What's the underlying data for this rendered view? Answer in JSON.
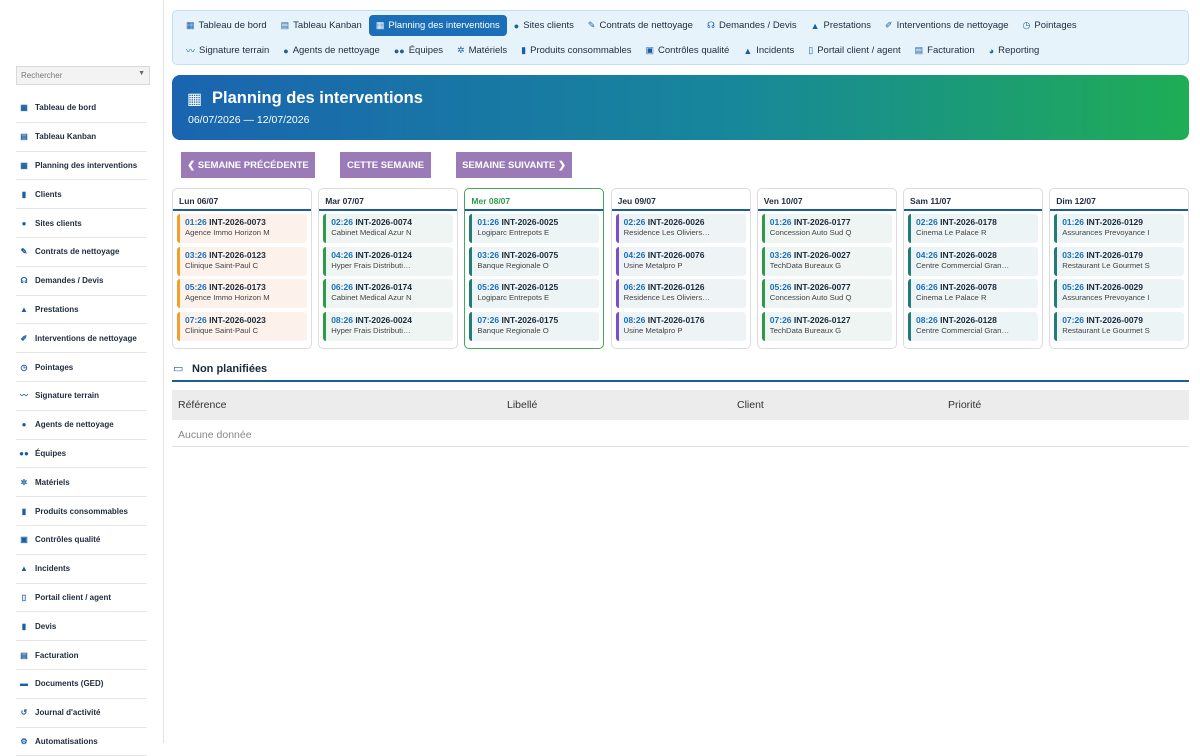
{
  "sidebar": {
    "search_placeholder": "Rechercher",
    "items": [
      {
        "icon": "dashboard-icon",
        "glyph": "▦",
        "label": "Tableau de bord"
      },
      {
        "icon": "kanban-icon",
        "glyph": "▤",
        "label": "Tableau Kanban"
      },
      {
        "icon": "calendar-icon",
        "glyph": "▦",
        "label": "Planning des interventions"
      },
      {
        "icon": "clients-icon",
        "glyph": "▮",
        "label": "Clients"
      },
      {
        "icon": "location-pin-icon",
        "glyph": "●",
        "label": "Sites clients"
      },
      {
        "icon": "contract-icon",
        "glyph": "✎",
        "label": "Contrats de nettoyage"
      },
      {
        "icon": "headset-icon",
        "glyph": "☊",
        "label": "Demandes / Devis"
      },
      {
        "icon": "service-icon",
        "glyph": "▲",
        "label": "Prestations"
      },
      {
        "icon": "broom-icon",
        "glyph": "✐",
        "label": "Interventions de nettoyage"
      },
      {
        "icon": "clock-icon",
        "glyph": "◷",
        "label": "Pointages"
      },
      {
        "icon": "signature-icon",
        "glyph": "〰",
        "label": "Signature terrain"
      },
      {
        "icon": "agent-icon",
        "glyph": "●",
        "label": "Agents de nettoyage"
      },
      {
        "icon": "team-icon",
        "glyph": "●●",
        "label": "Équipes"
      },
      {
        "icon": "gears-icon",
        "glyph": "✲",
        "label": "Matériels"
      },
      {
        "icon": "spray-icon",
        "glyph": "▮",
        "label": "Produits consommables"
      },
      {
        "icon": "clipboard-check-icon",
        "glyph": "▣",
        "label": "Contrôles qualité"
      },
      {
        "icon": "warning-icon",
        "glyph": "▲",
        "label": "Incidents"
      },
      {
        "icon": "mobile-icon",
        "glyph": "▯",
        "label": "Portail client / agent"
      },
      {
        "icon": "file-icon",
        "glyph": "▮",
        "label": "Devis"
      },
      {
        "icon": "invoice-icon",
        "glyph": "▤",
        "label": "Facturation"
      },
      {
        "icon": "folder-icon",
        "glyph": "▬",
        "label": "Documents (GED)"
      },
      {
        "icon": "history-icon",
        "glyph": "↺",
        "label": "Journal d'activité"
      },
      {
        "icon": "automation-icon",
        "glyph": "⚙",
        "label": "Automatisations"
      }
    ]
  },
  "topnav": {
    "row1": [
      {
        "icon": "dashboard-icon",
        "glyph": "▦",
        "label": "Tableau de bord"
      },
      {
        "icon": "kanban-icon",
        "glyph": "▤",
        "label": "Tableau Kanban"
      },
      {
        "icon": "calendar-icon",
        "glyph": "▦",
        "label": "Planning des interventions",
        "active": true
      },
      {
        "icon": "location-pin-icon",
        "glyph": "●",
        "label": "Sites clients"
      },
      {
        "icon": "contract-icon",
        "glyph": "✎",
        "label": "Contrats de nettoyage"
      },
      {
        "icon": "headset-icon",
        "glyph": "☊",
        "label": "Demandes / Devis"
      },
      {
        "icon": "service-icon",
        "glyph": "▲",
        "label": "Prestations"
      },
      {
        "icon": "broom-icon",
        "glyph": "✐",
        "label": "Interventions de nettoyage"
      },
      {
        "icon": "clock-icon",
        "glyph": "◷",
        "label": "Pointages"
      }
    ],
    "row2": [
      {
        "icon": "signature-icon",
        "glyph": "〰",
        "label": "Signature terrain"
      },
      {
        "icon": "agent-icon",
        "glyph": "●",
        "label": "Agents de nettoyage"
      },
      {
        "icon": "team-icon",
        "glyph": "●●",
        "label": "Équipes"
      },
      {
        "icon": "gears-icon",
        "glyph": "✲",
        "label": "Matériels"
      },
      {
        "icon": "spray-icon",
        "glyph": "▮",
        "label": "Produits consommables"
      },
      {
        "icon": "clipboard-check-icon",
        "glyph": "▣",
        "label": "Contrôles qualité"
      },
      {
        "icon": "warning-icon",
        "glyph": "▲",
        "label": "Incidents"
      },
      {
        "icon": "mobile-icon",
        "glyph": "▯",
        "label": "Portail client / agent"
      },
      {
        "icon": "invoice-icon",
        "glyph": "▤",
        "label": "Facturation"
      },
      {
        "icon": "pie-chart-icon",
        "glyph": "◕",
        "label": "Reporting"
      }
    ]
  },
  "banner": {
    "icon": "calendar-icon",
    "glyph": "▦",
    "title": "Planning des interventions",
    "range": "06/07/2026 — 12/07/2026"
  },
  "week_buttons": {
    "prev": "❮ SEMAINE PRÉCÉDENTE",
    "current": "CETTE SEMAINE",
    "next": "SEMAINE SUIVANTE ❯"
  },
  "days": [
    {
      "label": "Lun 06/07",
      "today": false,
      "events": [
        {
          "time": "01:26",
          "ref": "INT-2026-0073",
          "client": "Agence Immo Horizon M",
          "color": "orange"
        },
        {
          "time": "03:26",
          "ref": "INT-2026-0123",
          "client": "Clinique Saint-Paul C",
          "color": "orange"
        },
        {
          "time": "05:26",
          "ref": "INT-2026-0173",
          "client": "Agence Immo Horizon M",
          "color": "orange"
        },
        {
          "time": "07:26",
          "ref": "INT-2026-0023",
          "client": "Clinique Saint-Paul C",
          "color": "orange"
        }
      ]
    },
    {
      "label": "Mar 07/07",
      "today": false,
      "events": [
        {
          "time": "02:26",
          "ref": "INT-2026-0074",
          "client": "Cabinet Medical Azur N",
          "color": "green"
        },
        {
          "time": "04:26",
          "ref": "INT-2026-0124",
          "client": "Hyper Frais Distributi…",
          "color": "green"
        },
        {
          "time": "06:26",
          "ref": "INT-2026-0174",
          "client": "Cabinet Medical Azur N",
          "color": "green"
        },
        {
          "time": "08:26",
          "ref": "INT-2026-0024",
          "client": "Hyper Frais Distributi…",
          "color": "green"
        }
      ]
    },
    {
      "label": "Mer 08/07",
      "today": true,
      "events": [
        {
          "time": "01:26",
          "ref": "INT-2026-0025",
          "client": "Logiparc Entrepots E",
          "color": "teal"
        },
        {
          "time": "03:26",
          "ref": "INT-2026-0075",
          "client": "Banque Regionale O",
          "color": "teal"
        },
        {
          "time": "05:26",
          "ref": "INT-2026-0125",
          "client": "Logiparc Entrepots E",
          "color": "teal"
        },
        {
          "time": "07:26",
          "ref": "INT-2026-0175",
          "client": "Banque Regionale O",
          "color": "teal"
        }
      ]
    },
    {
      "label": "Jeu 09/07",
      "today": false,
      "events": [
        {
          "time": "02:26",
          "ref": "INT-2026-0026",
          "client": "Residence Les Oliviers…",
          "color": "purple"
        },
        {
          "time": "04:26",
          "ref": "INT-2026-0076",
          "client": "Usine Metalpro P",
          "color": "purple"
        },
        {
          "time": "06:26",
          "ref": "INT-2026-0126",
          "client": "Residence Les Oliviers…",
          "color": "purple"
        },
        {
          "time": "08:26",
          "ref": "INT-2026-0176",
          "client": "Usine Metalpro P",
          "color": "purple"
        }
      ]
    },
    {
      "label": "Ven 10/07",
      "today": false,
      "events": [
        {
          "time": "01:26",
          "ref": "INT-2026-0177",
          "client": "Concession Auto Sud Q",
          "color": "green"
        },
        {
          "time": "03:26",
          "ref": "INT-2026-0027",
          "client": "TechData Bureaux G",
          "color": "green"
        },
        {
          "time": "05:26",
          "ref": "INT-2026-0077",
          "client": "Concession Auto Sud Q",
          "color": "green"
        },
        {
          "time": "07:26",
          "ref": "INT-2026-0127",
          "client": "TechData Bureaux G",
          "color": "green"
        }
      ]
    },
    {
      "label": "Sam 11/07",
      "today": false,
      "events": [
        {
          "time": "02:26",
          "ref": "INT-2026-0178",
          "client": "Cinema Le Palace R",
          "color": "teal"
        },
        {
          "time": "04:26",
          "ref": "INT-2026-0028",
          "client": "Centre Commercial Gran…",
          "color": "teal"
        },
        {
          "time": "06:26",
          "ref": "INT-2026-0078",
          "client": "Cinema Le Palace R",
          "color": "teal"
        },
        {
          "time": "08:26",
          "ref": "INT-2026-0128",
          "client": "Centre Commercial Gran…",
          "color": "teal"
        }
      ]
    },
    {
      "label": "Dim 12/07",
      "today": false,
      "events": [
        {
          "time": "01:26",
          "ref": "INT-2026-0129",
          "client": "Assurances Prevoyance I",
          "color": "teal"
        },
        {
          "time": "03:26",
          "ref": "INT-2026-0179",
          "client": "Restaurant Le Gourmet S",
          "color": "teal"
        },
        {
          "time": "05:26",
          "ref": "INT-2026-0029",
          "client": "Assurances Prevoyance I",
          "color": "teal"
        },
        {
          "time": "07:26",
          "ref": "INT-2026-0079",
          "client": "Restaurant Le Gourmet S",
          "color": "teal"
        }
      ]
    }
  ],
  "unplanned": {
    "icon": "inbox-icon",
    "glyph": "▭",
    "title": "Non planifiées",
    "columns": [
      "Référence",
      "Libellé",
      "Client",
      "Priorité"
    ],
    "empty_text": "Aucune donnée"
  }
}
